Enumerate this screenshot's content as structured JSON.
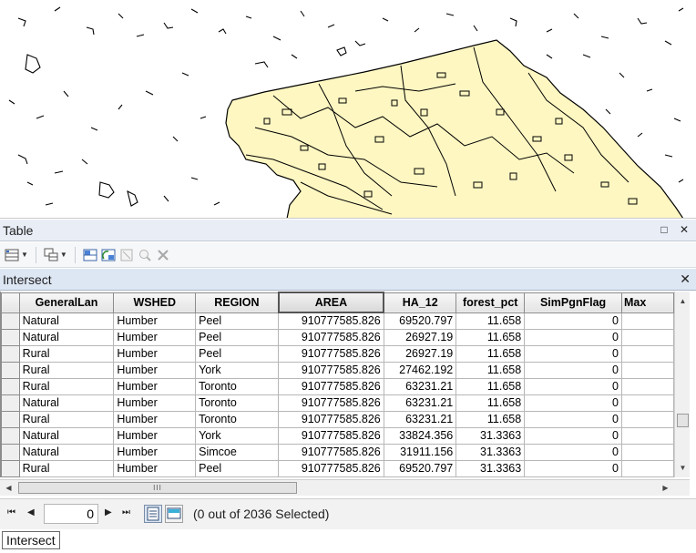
{
  "window": {
    "title": "Table",
    "maximize_glyph": "□",
    "close_glyph": "✕"
  },
  "toolbar": {
    "icons": [
      "table-options-icon",
      "related-tables-icon",
      "select-by-attributes-icon",
      "switch-selection-icon",
      "clear-selection-icon",
      "zoom-to-selected-icon",
      "delete-selected-icon"
    ]
  },
  "tab": {
    "title": "Intersect",
    "close_glyph": "✕"
  },
  "grid": {
    "columns": [
      "GeneralLan",
      "WSHED",
      "REGION",
      "AREA",
      "HA_12",
      "forest_pct",
      "SimPgnFlag",
      "Max"
    ],
    "sorted_column": "AREA",
    "rows": [
      [
        "Natural",
        "Humber",
        "Peel",
        "910777585.826",
        "69520.797",
        "11.658",
        "0"
      ],
      [
        "Natural",
        "Humber",
        "Peel",
        "910777585.826",
        "26927.19",
        "11.658",
        "0"
      ],
      [
        "Rural",
        "Humber",
        "Peel",
        "910777585.826",
        "26927.19",
        "11.658",
        "0"
      ],
      [
        "Rural",
        "Humber",
        "York",
        "910777585.826",
        "27462.192",
        "11.658",
        "0"
      ],
      [
        "Rural",
        "Humber",
        "Toronto",
        "910777585.826",
        "63231.21",
        "11.658",
        "0"
      ],
      [
        "Natural",
        "Humber",
        "Toronto",
        "910777585.826",
        "63231.21",
        "11.658",
        "0"
      ],
      [
        "Rural",
        "Humber",
        "Toronto",
        "910777585.826",
        "63231.21",
        "11.658",
        "0"
      ],
      [
        "Natural",
        "Humber",
        "York",
        "910777585.826",
        "33824.356",
        "31.3363",
        "0"
      ],
      [
        "Natural",
        "Humber",
        "Simcoe",
        "910777585.826",
        "31911.156",
        "31.3363",
        "0"
      ],
      [
        "Rural",
        "Humber",
        "Peel",
        "910777585.826",
        "69520.797",
        "31.3363",
        "0"
      ]
    ]
  },
  "navigation": {
    "first_glyph": "⏮",
    "prev_glyph": "◀",
    "next_glyph": "▶",
    "last_glyph": "⏭",
    "record_value": "0",
    "status": "(0 out of 2036 Selected)"
  },
  "bottom_tab": {
    "label": "Intersect"
  },
  "colors": {
    "map_fill": "#fef7c2",
    "map_stroke": "#000000",
    "title_bar": "#e9eef6",
    "tab_header": "#dde6f3"
  }
}
